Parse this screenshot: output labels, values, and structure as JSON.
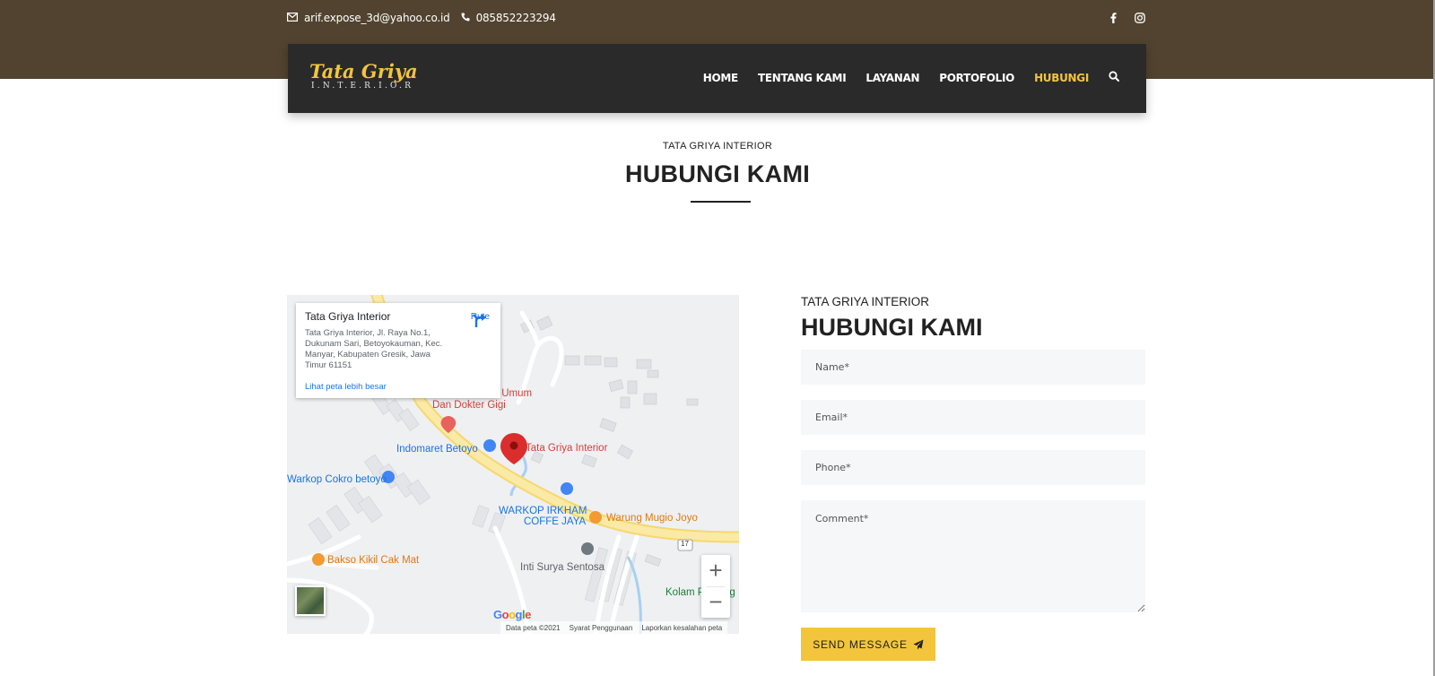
{
  "topbar": {
    "email": "arif.expose_3d@yahoo.co.id",
    "phone": "085852223294",
    "social": [
      "facebook-icon",
      "instagram-icon"
    ],
    "bg_color": "#51432f"
  },
  "navbar": {
    "logo_line1": "Tata Griya",
    "logo_line2": "I.N.T.E.R.I.O.R",
    "items": [
      {
        "label": "HOME",
        "active": false
      },
      {
        "label": "TENTANG KAMI",
        "active": false
      },
      {
        "label": "LAYANAN",
        "active": false
      },
      {
        "label": "PORTOFOLIO",
        "active": false
      },
      {
        "label": "HUBUNGI",
        "active": true
      }
    ],
    "accent": "#f2c53d"
  },
  "page": {
    "eyebrow": "TATA GRIYA INTERIOR",
    "title": "HUBUNGI KAMI"
  },
  "map": {
    "card_title": "Tata Griya Interior",
    "card_address": "Tata Griya Interior, Jl. Raya No.1, Dukunam Sari, Betoyokauman, Kec. Manyar, Kabupaten Gresik, Jawa Timur 61151",
    "card_link": "Lihat peta lebih besar",
    "route_label": "Rute",
    "labels": {
      "clinic": "Praktek Dokter Umum",
      "clinic2": "Dan Dokter Gigi",
      "indomaret": "Indomaret Betoyo",
      "main_pin": "Tata Griya Interior",
      "warkop_cokro": "Warkop Cokro betoyo",
      "warkop_irkham1": "WARKOP IRKHAM",
      "warkop_irkham2": "COFFE JAYA",
      "warung": "Warung Mugio Joyo",
      "bakso": "Bakso Kikil Cak Mat",
      "inti": "Inti Surya Sentosa",
      "kolam": "Kolam P",
      "kolam2": "ng",
      "road_number": "17"
    },
    "zoom_in": "+",
    "zoom_out": "−",
    "google": "Google",
    "footer": [
      "Data peta ©2021",
      "Syarat Penggunaan",
      "Laporkan kesalahan peta"
    ]
  },
  "form": {
    "eyebrow": "TATA GRIYA INTERIOR",
    "title": "HUBUNGI KAMI",
    "name_placeholder": "Name*",
    "email_placeholder": "Email*",
    "phone_placeholder": "Phone*",
    "comment_placeholder": "Comment*",
    "submit_label": "SEND MESSAGE"
  }
}
